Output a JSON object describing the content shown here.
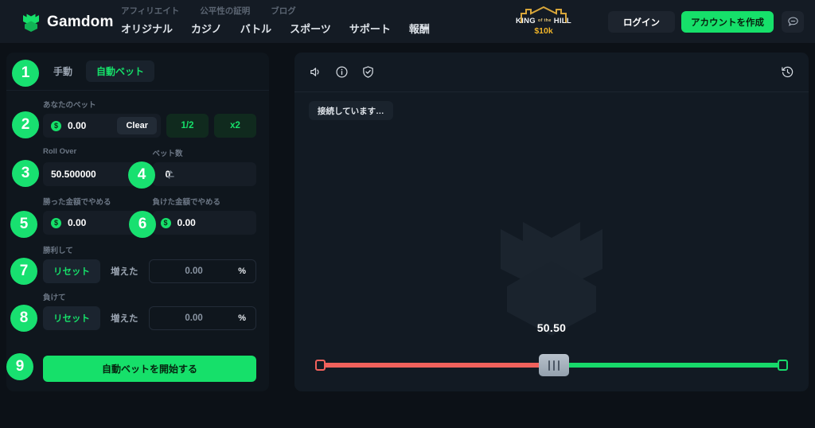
{
  "header": {
    "brand": "Gamdom",
    "brand_icon": "castle-logo-icon",
    "nav_top": [
      "アフィリエイト",
      "公平性の証明",
      "ブログ"
    ],
    "nav_main": [
      "オリジナル",
      "カジノ",
      "バトル",
      "スポーツ",
      "サポート",
      "報酬"
    ],
    "promo": {
      "line1_left": "KING",
      "line1_mid": "of the",
      "line1_right": "HILL",
      "line2": "$10k"
    },
    "login_label": "ログイン",
    "register_label": "アカウントを作成",
    "chat_icon": "chat-bubble-icon"
  },
  "bet_panel": {
    "tabs": [
      {
        "label": "手動",
        "active": false
      },
      {
        "label": "自動ベット",
        "active": true
      }
    ],
    "your_bet": {
      "label": "あなたのベット",
      "currency_symbol": "$",
      "value": "0.00",
      "clear_label": "Clear",
      "half_label": "1/2",
      "double_label": "x2"
    },
    "roll_over": {
      "label": "Roll Over",
      "value": "50.500000",
      "swap_icon": "swap-arrows-icon"
    },
    "bet_count": {
      "label": "ベット数",
      "value": "0"
    },
    "stop_on_profit": {
      "label": "勝った金額でやめる",
      "currency_symbol": "$",
      "value": "0.00"
    },
    "stop_on_loss": {
      "label": "負けた金額でやめる",
      "currency_symbol": "$",
      "value": "0.00"
    },
    "on_win": {
      "label": "勝利して",
      "reset_label": "リセット",
      "increase_label": "増えた",
      "amount": "0.00",
      "unit": "%"
    },
    "on_loss": {
      "label": "負けて",
      "reset_label": "リセット",
      "increase_label": "増えた",
      "amount": "0.00",
      "unit": "%"
    },
    "start_label": "自動ベットを開始する"
  },
  "badges": [
    {
      "number": "1"
    },
    {
      "number": "2"
    },
    {
      "number": "3"
    },
    {
      "number": "4"
    },
    {
      "number": "5"
    },
    {
      "number": "6"
    },
    {
      "number": "7"
    },
    {
      "number": "8"
    },
    {
      "number": "9"
    }
  ],
  "game_panel": {
    "toolbar_icons": [
      "sound-icon",
      "info-icon",
      "shield-check-icon",
      "history-icon"
    ],
    "status": "接続しています…",
    "watermark_icon": "gamdom-castle-watermark-icon",
    "slider": {
      "value": "50.50",
      "percent": 50.5,
      "low_color": "#f0615c",
      "high_color": "#17d96a"
    }
  },
  "colors": {
    "accent_green": "#16e06a",
    "panel_bg": "#0f161d",
    "game_bg": "#121a23",
    "page_bg": "#0c1117",
    "header_bg": "#141b24"
  }
}
